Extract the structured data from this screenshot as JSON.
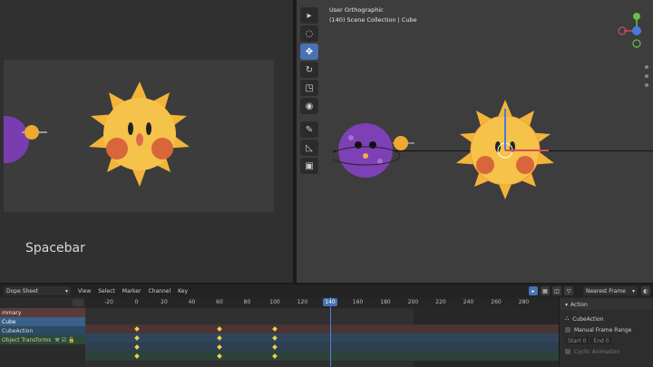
{
  "left_view": {
    "overlay_text": "Spacebar"
  },
  "viewport": {
    "header_line1": "User Orthographic",
    "header_line2": "(140) Scene Collection | Cube",
    "tools": [
      "cursor-icon",
      "select-icon",
      "move-icon",
      "rotate-icon",
      "scale-icon",
      "transform-icon",
      "annotate-icon",
      "measure-icon",
      "add-cube-icon"
    ],
    "active_tool": 2
  },
  "dopesheet": {
    "editor_type": "Dope Sheet",
    "menus": [
      "View",
      "Select",
      "Marker",
      "Channel",
      "Key"
    ],
    "snapping": "Nearest Frame",
    "ruler_ticks": [
      "-20",
      "0",
      "20",
      "40",
      "60",
      "80",
      "100",
      "120",
      "140",
      "160",
      "180",
      "200",
      "220",
      "240",
      "260",
      "280"
    ],
    "current_frame": "140",
    "channels": {
      "summary": "mmary",
      "cube": "Cube",
      "action": "CubeAction",
      "transforms": "Object Transforms"
    },
    "keyframes": [
      0,
      60,
      100
    ],
    "panel": {
      "title": "Action",
      "action_name": "CubeAction",
      "manual_range": "Manual Frame Range",
      "start_label": "Start",
      "start_value": "0",
      "end_label": "End",
      "end_value": "0",
      "cyclic": "Cyclic Animation"
    }
  },
  "colors": {
    "accent": "#4772b3",
    "keyframe": "#e8d44a"
  }
}
